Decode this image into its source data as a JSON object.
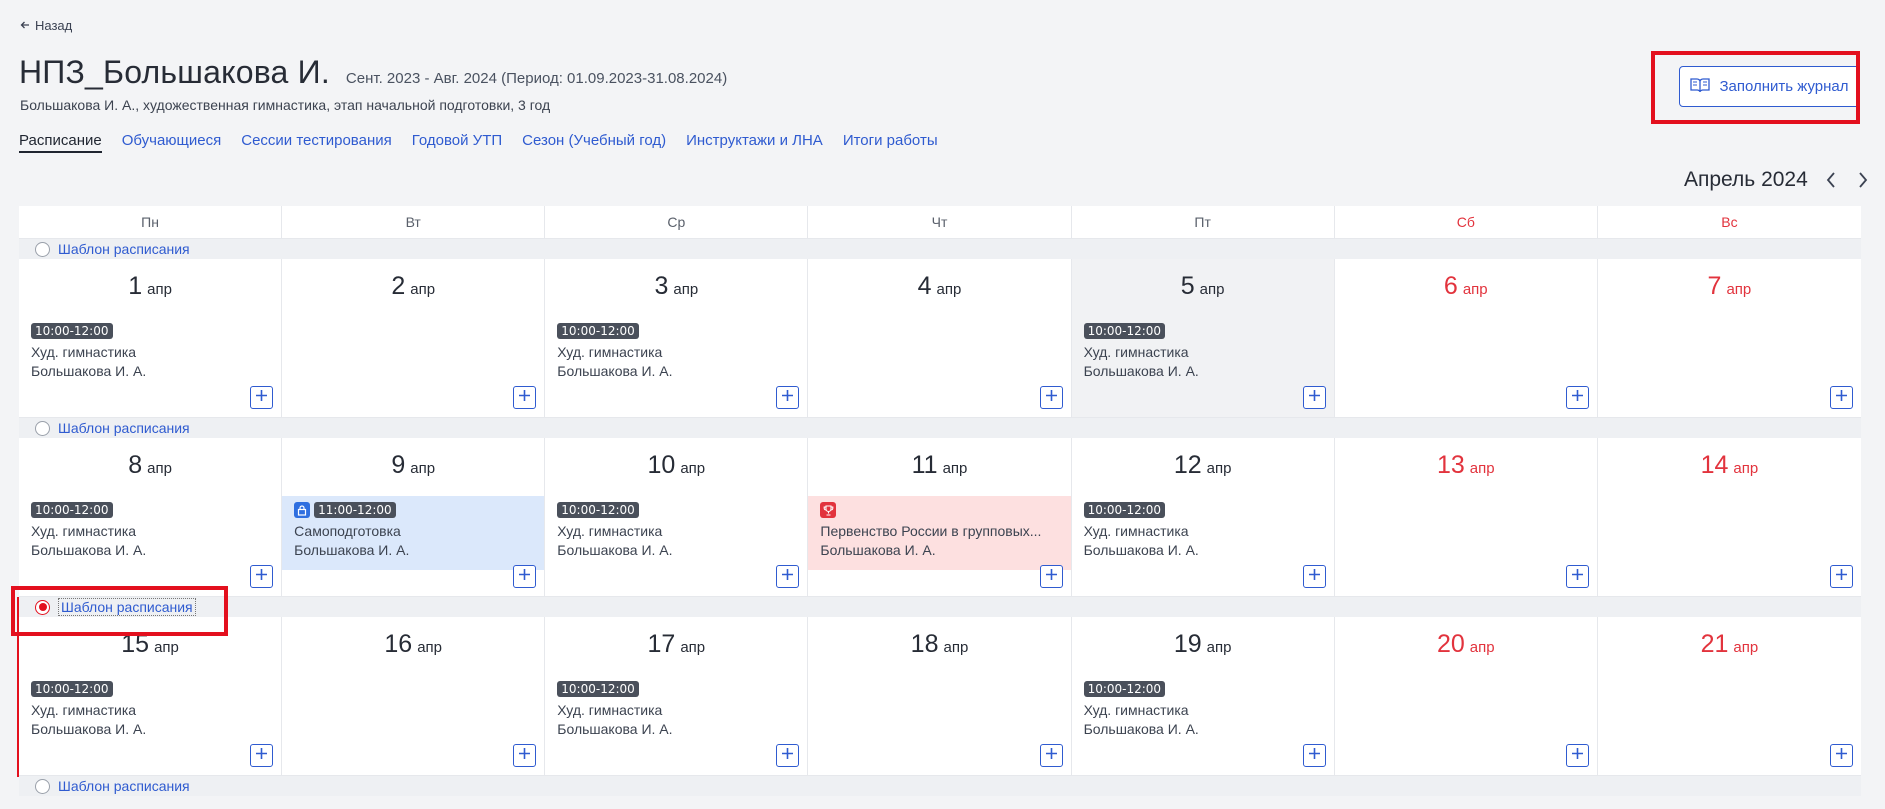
{
  "back": {
    "label": "Назад",
    "icon": "arrow-left-icon"
  },
  "header": {
    "title": "НПЗ_Большакова И.",
    "period": "Сент. 2023 - Авг. 2024 (Период: 01.09.2023-31.08.2024)",
    "subtitle": "Большакова И. А., художественная гимнастика, этап начальной подготовки, 3 год"
  },
  "tabs": [
    {
      "label": "Расписание",
      "active": true
    },
    {
      "label": "Обучающиеся"
    },
    {
      "label": "Сессии тестирования"
    },
    {
      "label": "Годовой УТП"
    },
    {
      "label": "Сезон (Учебный год)"
    },
    {
      "label": "Инструктажи и ЛНА"
    },
    {
      "label": "Итоги работы"
    }
  ],
  "fill_button": {
    "label": "Заполнить журнал",
    "icon": "book-icon"
  },
  "calendar": {
    "month_label": "Апрель 2024",
    "weekdays": [
      "Пн",
      "Вт",
      "Ср",
      "Чт",
      "Пт",
      "Сб",
      "Вс"
    ],
    "template_label": "Шаблон расписания",
    "weeks": [
      {
        "template_selected": false,
        "days": [
          {
            "num": "1",
            "mon": "апр",
            "event": {
              "time": "10:00-12:00",
              "title": "Худ. гимнастика",
              "coach": "Большакова И. А."
            }
          },
          {
            "num": "2",
            "mon": "апр"
          },
          {
            "num": "3",
            "mon": "апр",
            "event": {
              "time": "10:00-12:00",
              "title": "Худ. гимнастика",
              "coach": "Большакова И. А."
            }
          },
          {
            "num": "4",
            "mon": "апр"
          },
          {
            "num": "5",
            "mon": "апр",
            "gray": true,
            "event": {
              "time": "10:00-12:00",
              "title": "Худ. гимнастика",
              "coach": "Большакова И. А."
            }
          },
          {
            "num": "6",
            "mon": "апр",
            "weekend": true
          },
          {
            "num": "7",
            "mon": "апр",
            "weekend": true
          }
        ]
      },
      {
        "template_selected": false,
        "days": [
          {
            "num": "8",
            "mon": "апр",
            "event": {
              "time": "10:00-12:00",
              "title": "Худ. гимнастика",
              "coach": "Большакова И. А."
            }
          },
          {
            "num": "9",
            "mon": "апр",
            "event": {
              "kind": "self",
              "time": "11:00-12:00",
              "title": "Самоподготовка",
              "coach": "Большакова И. А."
            }
          },
          {
            "num": "10",
            "mon": "апр",
            "event": {
              "time": "10:00-12:00",
              "title": "Худ. гимнастика",
              "coach": "Большакова И. А."
            }
          },
          {
            "num": "11",
            "mon": "апр",
            "event": {
              "kind": "competition",
              "title": "Первенство России в групповых...",
              "coach": "Большакова И. А."
            }
          },
          {
            "num": "12",
            "mon": "апр",
            "event": {
              "time": "10:00-12:00",
              "title": "Худ. гимнастика",
              "coach": "Большакова И. А."
            }
          },
          {
            "num": "13",
            "mon": "апр",
            "weekend": true
          },
          {
            "num": "14",
            "mon": "апр",
            "weekend": true
          }
        ]
      },
      {
        "template_selected": true,
        "days": [
          {
            "num": "15",
            "mon": "апр",
            "event": {
              "time": "10:00-12:00",
              "title": "Худ. гимнастика",
              "coach": "Большакова И. А."
            }
          },
          {
            "num": "16",
            "mon": "апр"
          },
          {
            "num": "17",
            "mon": "апр",
            "event": {
              "time": "10:00-12:00",
              "title": "Худ. гимнастика",
              "coach": "Большакова И. А."
            }
          },
          {
            "num": "18",
            "mon": "апр"
          },
          {
            "num": "19",
            "mon": "апр",
            "event": {
              "time": "10:00-12:00",
              "title": "Худ. гимнастика",
              "coach": "Большакова И. А."
            }
          },
          {
            "num": "20",
            "mon": "апр",
            "weekend": true
          },
          {
            "num": "21",
            "mon": "апр",
            "weekend": true
          }
        ]
      }
    ],
    "trailing_template_selected": false
  },
  "colors": {
    "accent": "#2f5bd0",
    "weekend": "#e2333d",
    "highlight": "#e3101e"
  }
}
